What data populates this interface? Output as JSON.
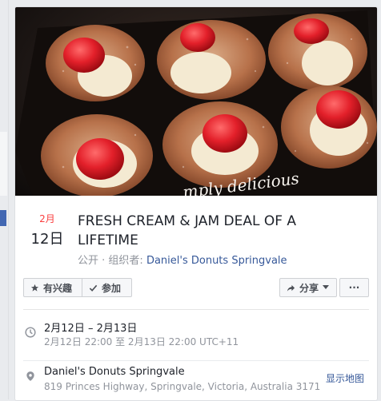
{
  "event": {
    "cover_caption": "...mply delicious",
    "month": "2月",
    "day": "12日",
    "title": "FRESH CREAM & JAM DEAL OF A LIFETIME",
    "visibility": "公开",
    "organizer_label": "组织者:",
    "organizer": "Daniel's Donuts Springvale"
  },
  "actions": {
    "interested": "有兴趣",
    "going": "参加",
    "share": "分享",
    "more": "···"
  },
  "details": {
    "date_range": "2月12日 – 2月13日",
    "time_range": "2月12日 22:00 至 2月13日 22:00 UTC+11",
    "place_name": "Daniel's Donuts Springvale",
    "address": "819 Princes Highway, Springvale, Victoria, Australia 3171",
    "map_link": "显示地图"
  },
  "icons": {
    "interested": "star-icon",
    "going": "check-icon",
    "share": "share-arrow-icon",
    "share_caret": "caret-down-icon",
    "time": "clock-icon",
    "place": "map-pin-icon"
  },
  "colors": {
    "month_red": "#fa3e3e",
    "link_blue": "#365899",
    "jam_red": "#e3202a"
  }
}
